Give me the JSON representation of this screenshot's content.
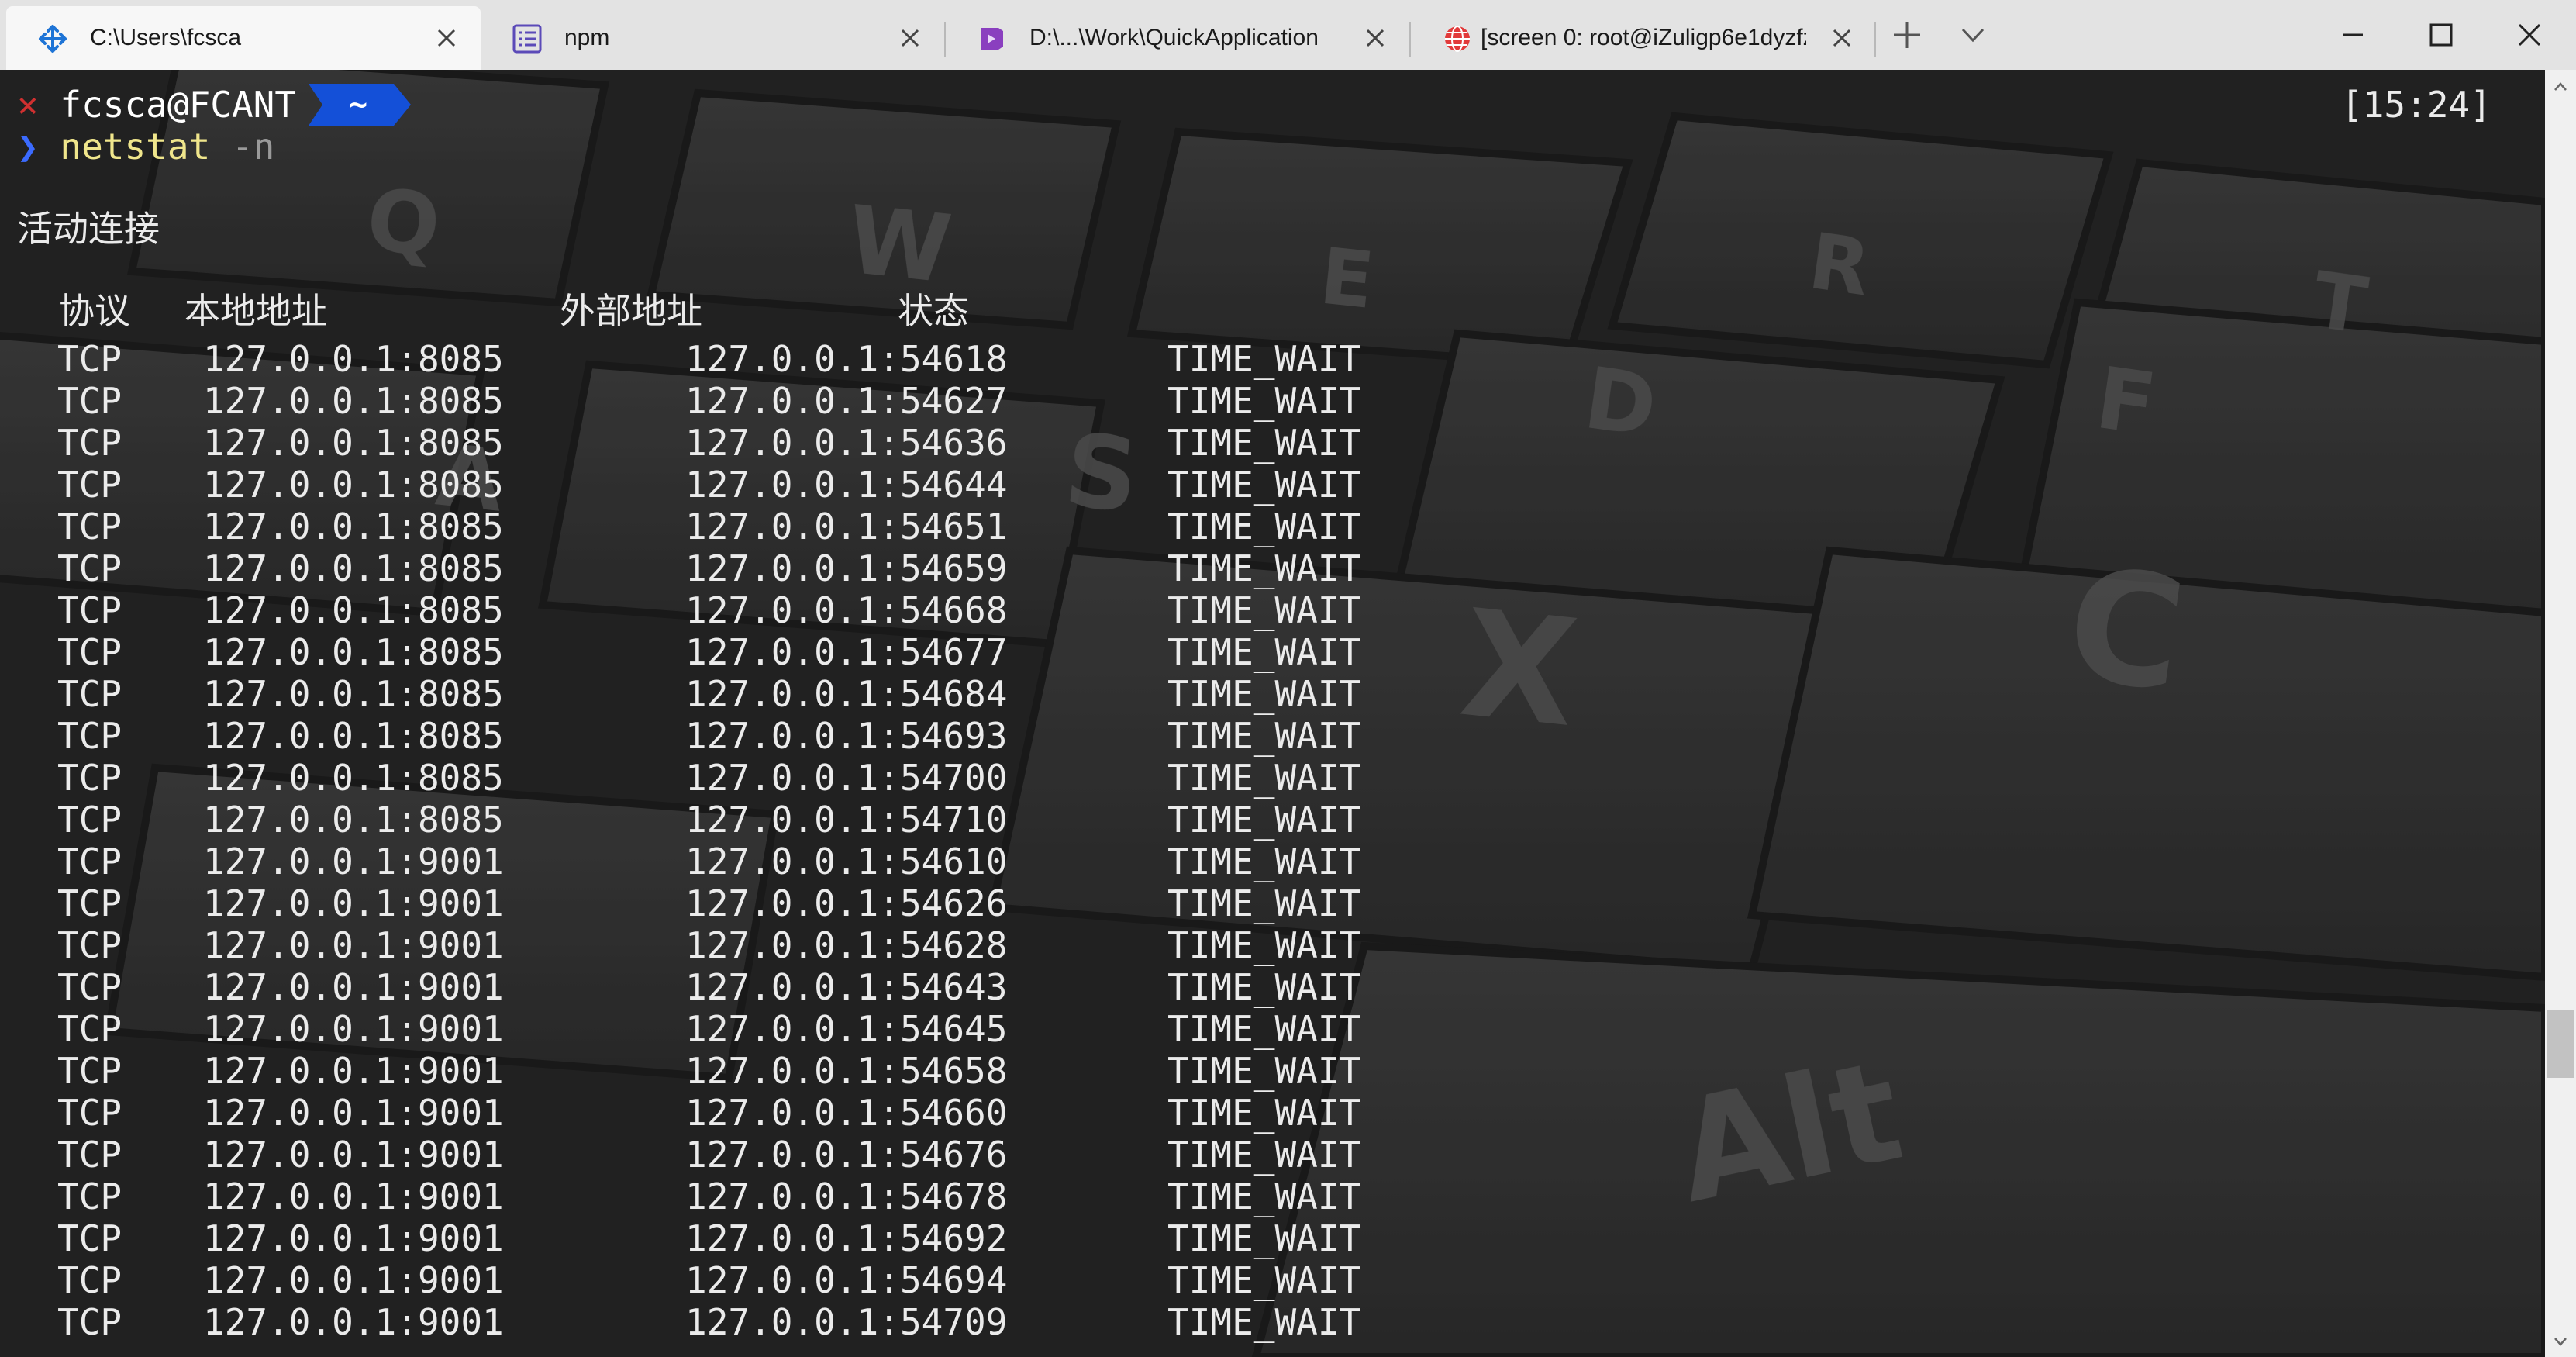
{
  "tabs": [
    {
      "title": "C:\\Users\\fcsca",
      "icon": "terminal-app-icon",
      "active": true
    },
    {
      "title": "npm",
      "icon": "terminal-list-icon",
      "active": false
    },
    {
      "title": "D:\\...\\Work\\QuickApplication",
      "icon": "visual-studio-icon",
      "active": false
    },
    {
      "title": "[screen 0: root@iZuligp6e1dyzfz",
      "icon": "globe-icon",
      "active": false
    }
  ],
  "tabbar": {
    "new_tab_icon": "plus-icon",
    "dropdown_icon": "chevron-down-icon"
  },
  "window_controls": [
    "minimize-icon",
    "maximize-icon",
    "close-icon"
  ],
  "prompt": {
    "status_glyph": "×",
    "user_host": "fcsca@FCANT",
    "directory": "~",
    "time": "[15:24]",
    "arrow": "❯",
    "command": "netstat",
    "flag": "-n"
  },
  "output": {
    "heading": "活动连接",
    "columns": {
      "proto": "协议",
      "local": "本地地址",
      "foreign": "外部地址",
      "state": "状态"
    },
    "rows": [
      [
        "TCP",
        "127.0.0.1:8085",
        "127.0.0.1:54618",
        "TIME_WAIT"
      ],
      [
        "TCP",
        "127.0.0.1:8085",
        "127.0.0.1:54627",
        "TIME_WAIT"
      ],
      [
        "TCP",
        "127.0.0.1:8085",
        "127.0.0.1:54636",
        "TIME_WAIT"
      ],
      [
        "TCP",
        "127.0.0.1:8085",
        "127.0.0.1:54644",
        "TIME_WAIT"
      ],
      [
        "TCP",
        "127.0.0.1:8085",
        "127.0.0.1:54651",
        "TIME_WAIT"
      ],
      [
        "TCP",
        "127.0.0.1:8085",
        "127.0.0.1:54659",
        "TIME_WAIT"
      ],
      [
        "TCP",
        "127.0.0.1:8085",
        "127.0.0.1:54668",
        "TIME_WAIT"
      ],
      [
        "TCP",
        "127.0.0.1:8085",
        "127.0.0.1:54677",
        "TIME_WAIT"
      ],
      [
        "TCP",
        "127.0.0.1:8085",
        "127.0.0.1:54684",
        "TIME_WAIT"
      ],
      [
        "TCP",
        "127.0.0.1:8085",
        "127.0.0.1:54693",
        "TIME_WAIT"
      ],
      [
        "TCP",
        "127.0.0.1:8085",
        "127.0.0.1:54700",
        "TIME_WAIT"
      ],
      [
        "TCP",
        "127.0.0.1:8085",
        "127.0.0.1:54710",
        "TIME_WAIT"
      ],
      [
        "TCP",
        "127.0.0.1:9001",
        "127.0.0.1:54610",
        "TIME_WAIT"
      ],
      [
        "TCP",
        "127.0.0.1:9001",
        "127.0.0.1:54626",
        "TIME_WAIT"
      ],
      [
        "TCP",
        "127.0.0.1:9001",
        "127.0.0.1:54628",
        "TIME_WAIT"
      ],
      [
        "TCP",
        "127.0.0.1:9001",
        "127.0.0.1:54643",
        "TIME_WAIT"
      ],
      [
        "TCP",
        "127.0.0.1:9001",
        "127.0.0.1:54645",
        "TIME_WAIT"
      ],
      [
        "TCP",
        "127.0.0.1:9001",
        "127.0.0.1:54658",
        "TIME_WAIT"
      ],
      [
        "TCP",
        "127.0.0.1:9001",
        "127.0.0.1:54660",
        "TIME_WAIT"
      ],
      [
        "TCP",
        "127.0.0.1:9001",
        "127.0.0.1:54676",
        "TIME_WAIT"
      ],
      [
        "TCP",
        "127.0.0.1:9001",
        "127.0.0.1:54678",
        "TIME_WAIT"
      ],
      [
        "TCP",
        "127.0.0.1:9001",
        "127.0.0.1:54692",
        "TIME_WAIT"
      ],
      [
        "TCP",
        "127.0.0.1:9001",
        "127.0.0.1:54694",
        "TIME_WAIT"
      ],
      [
        "TCP",
        "127.0.0.1:9001",
        "127.0.0.1:54709",
        "TIME_WAIT"
      ]
    ]
  },
  "background_keys": [
    "Q",
    "W",
    "E",
    "R",
    "T",
    "A",
    "S",
    "D",
    "F",
    "X",
    "C",
    "Alt"
  ],
  "colors": {
    "prompt_badge": "#1450d8",
    "prompt_arrow": "#3b6bff",
    "command": "#f0e68c",
    "error_x": "#d03030"
  }
}
